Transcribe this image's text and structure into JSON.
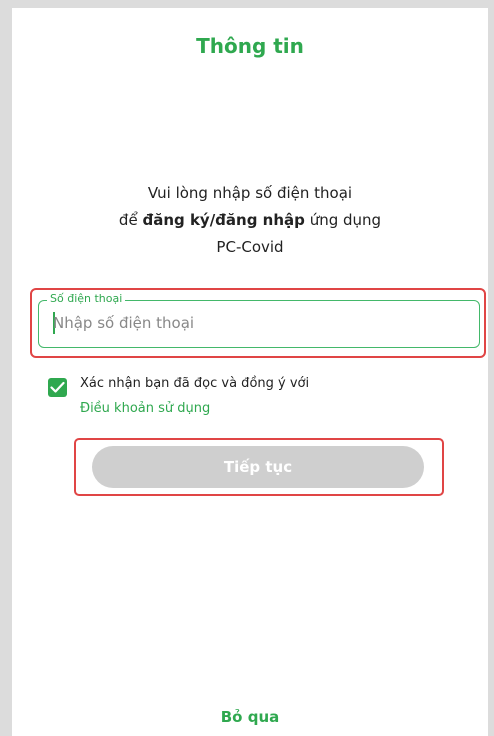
{
  "header": {
    "title": "Thông tin"
  },
  "intro": {
    "line1": "Vui lòng nhập số điện thoại",
    "line2_prefix": "để",
    "line2_bold": "đăng ký/đăng nhập",
    "line2_suffix": "ứng dụng",
    "line3": "PC-Covid"
  },
  "phone": {
    "label": "Số điện thoại",
    "placeholder": "Nhập số điện thoại",
    "value": ""
  },
  "consent": {
    "checked": true,
    "text": "Xác nhận bạn đã đọc và đồng ý với",
    "terms_link": "Điều khoản sử dụng"
  },
  "actions": {
    "continue_label": "Tiếp tục",
    "skip_label": "Bỏ qua"
  },
  "colors": {
    "accent": "#2fa84f",
    "highlight": "#e04545",
    "disabled_button": "#cfcfcf"
  }
}
